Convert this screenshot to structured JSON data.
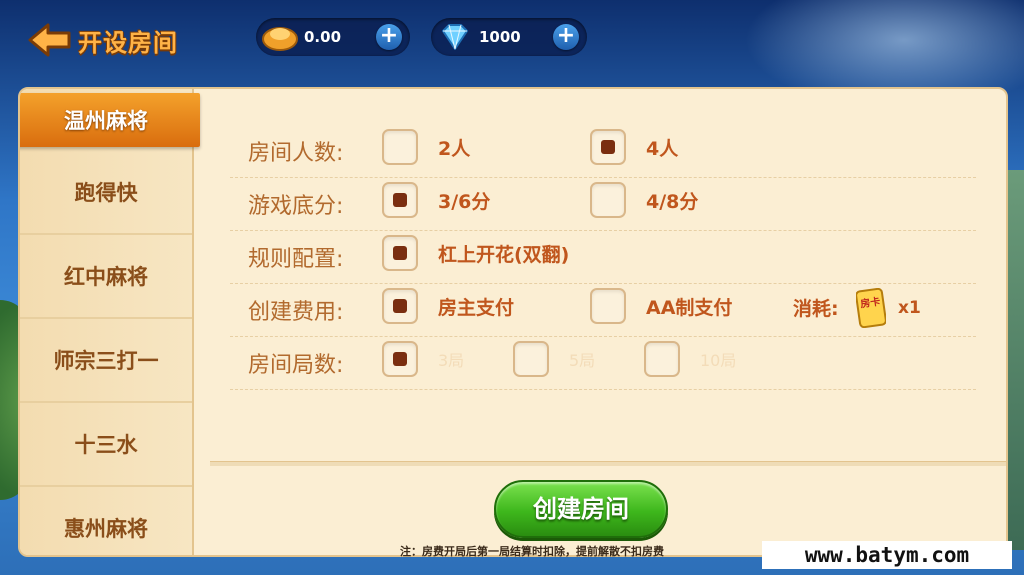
{
  "header": {
    "title": "开设房间",
    "gold": "0.00",
    "diamond": "1000",
    "plus": "+"
  },
  "sidebar": {
    "items": [
      {
        "label": "温州麻将",
        "active": true
      },
      {
        "label": "跑得快"
      },
      {
        "label": "红中麻将"
      },
      {
        "label": "师宗三打一"
      },
      {
        "label": "十三水"
      },
      {
        "label": "惠州麻将"
      }
    ]
  },
  "settings": {
    "players": {
      "label": "房间人数:",
      "options": [
        {
          "label": "2人",
          "checked": false
        },
        {
          "label": "4人",
          "checked": true
        }
      ]
    },
    "base_score": {
      "label": "游戏底分:",
      "options": [
        {
          "label": "3/6分",
          "checked": true
        },
        {
          "label": "4/8分",
          "checked": false
        }
      ]
    },
    "rules": {
      "label": "规则配置:",
      "options": [
        {
          "label": "杠上开花(双翻)",
          "checked": true
        }
      ]
    },
    "cost": {
      "label": "创建费用:",
      "options": [
        {
          "label": "房主支付",
          "checked": true
        },
        {
          "label": "AA制支付",
          "checked": false
        }
      ],
      "consume_label": "消耗:",
      "card_text": "房卡",
      "card_count": "x1"
    },
    "rounds": {
      "label": "房间局数:",
      "options": [
        {
          "label": "3局",
          "checked": true
        },
        {
          "label": "5局",
          "checked": false
        },
        {
          "label": "10局",
          "checked": false
        }
      ]
    }
  },
  "create_button": "创建房间",
  "note": "注：房费开局后第一局结算时扣除，提前解散不扣房费",
  "watermark": "www.batym.com",
  "colors": {
    "accent": "#d96d0e",
    "label": "#b26a2e",
    "option": "#c0561d",
    "panel": "#fbeed3",
    "button": "#3eb71c"
  }
}
